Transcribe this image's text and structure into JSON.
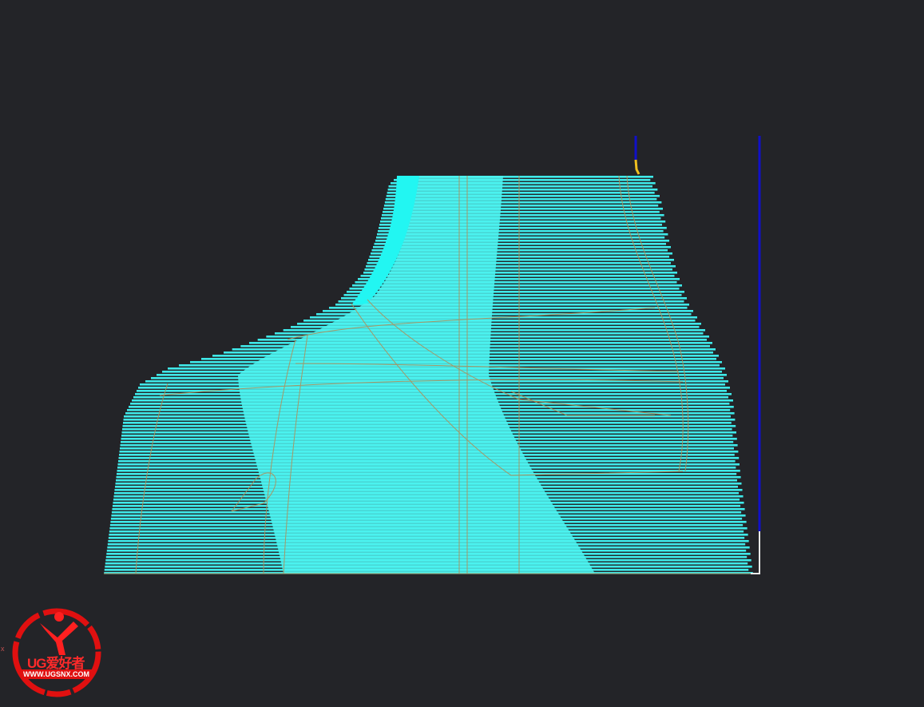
{
  "viewport": {
    "background": "#232428",
    "toolpath_color": "#3fe9e9",
    "toolpath_solid_color": "#4ef3f0",
    "wireframe_color": "#b0905a",
    "tool_axis_color": "#1010c8",
    "tool_tip_color": "#f0c020"
  },
  "axis_label": "x",
  "logo": {
    "title": "UG爱好者",
    "url": "WWW.UGSNX.COM"
  }
}
